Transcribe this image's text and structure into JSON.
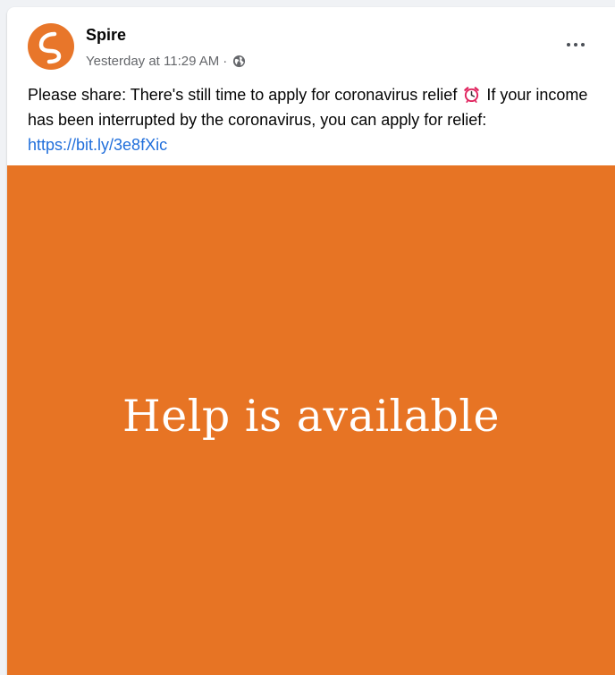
{
  "post": {
    "author": "Spire",
    "timestamp": "Yesterday at 11:29 AM",
    "separator": "·",
    "audience_icon": "globe-icon",
    "more_icon": "more-options-icon",
    "message_part1": "Please share: There's still time to apply for coronavirus relief",
    "message_emoji": "alarm-clock-icon",
    "message_part2": "If your income has been interrupted by the coronavirus, you can apply for relief:",
    "link_text": "https://bit.ly/3e8fXic"
  },
  "media": {
    "headline": "Help is available",
    "background_color": "#e77424"
  },
  "colors": {
    "brand": "#e8762a",
    "link": "#216fdb",
    "secondary_text": "#65676b"
  }
}
